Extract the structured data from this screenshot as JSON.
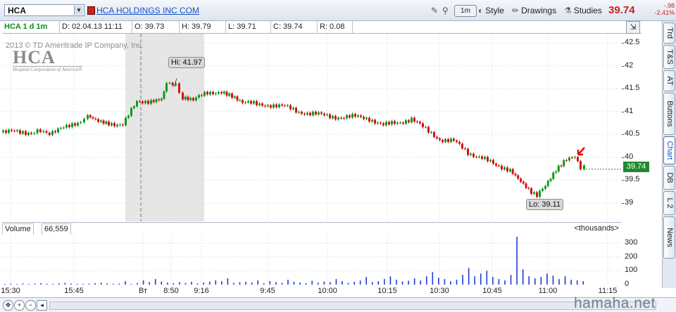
{
  "toolbar": {
    "symbol": "HCA",
    "company_name": "HCA HOLDINGS INC COM",
    "interval": "1m",
    "style_label": "Style",
    "drawings_label": "Drawings",
    "studies_label": "Studies",
    "last_price": "39.74",
    "net_change": "-.98",
    "pct_change": "-2.41%"
  },
  "info": {
    "ticker_interval": "HCA 1 d 1m",
    "date": "D: 02.04.13 11:11",
    "open": "O: 39.73",
    "high": "H: 39.79",
    "low": "L: 39.71",
    "close": "C: 39.74",
    "range": "R: 0.08"
  },
  "chart_overlay": {
    "copyright": "2013 © TD Ameritrade IP Company, Inc.",
    "logo_main": "HCA",
    "logo_sub": "Hospital Corporation of America®",
    "hi_label": "Hi: 41.97",
    "lo_label": "Lo: 39.11",
    "price_flag": "39.74"
  },
  "volume_pane": {
    "title": "Volume",
    "value": "66,559",
    "units": "<thousands>"
  },
  "right_tabs": [
    "Trd",
    "T&S",
    "AT",
    "Buttons",
    "Chart",
    "DB",
    "L 2",
    "News"
  ],
  "watermark": "hamaha.net",
  "chart_data": {
    "type": "candlestick",
    "price_axis_ticks": [
      "42.5",
      "42",
      "41.5",
      "41",
      "40.5",
      "40",
      "39.5",
      "39"
    ],
    "volume_axis_ticks": [
      "300",
      "200",
      "100",
      "0"
    ],
    "time_axis_ticks": [
      "15:30",
      "15:45",
      "Вт",
      "8:50",
      "9:16",
      "9:45",
      "10:00",
      "10:15",
      "10:30",
      "10:45",
      "11:00",
      "11:15"
    ],
    "high": 41.97,
    "low": 39.11,
    "last": 39.74,
    "ylim": [
      38.6,
      42.7
    ],
    "volume_ylim": [
      0,
      350
    ],
    "price_path": [
      [
        0,
        40.55
      ],
      [
        40,
        40.55
      ],
      [
        70,
        40.55
      ],
      [
        90,
        40.65
      ],
      [
        110,
        40.8
      ],
      [
        120,
        40.9
      ],
      [
        135,
        40.8
      ],
      [
        150,
        40.75
      ],
      [
        170,
        40.72
      ],
      [
        190,
        41.2
      ],
      [
        210,
        41.25
      ],
      [
        225,
        41.3
      ],
      [
        232,
        41.65
      ],
      [
        245,
        41.55
      ],
      [
        255,
        41.3
      ],
      [
        270,
        41.25
      ],
      [
        290,
        41.4
      ],
      [
        310,
        41.45
      ],
      [
        325,
        41.35
      ],
      [
        340,
        41.2
      ],
      [
        360,
        41.15
      ],
      [
        380,
        41.15
      ],
      [
        400,
        41.1
      ],
      [
        420,
        41.0
      ],
      [
        440,
        40.95
      ],
      [
        460,
        40.9
      ],
      [
        480,
        40.88
      ],
      [
        500,
        40.88
      ],
      [
        520,
        40.85
      ],
      [
        540,
        40.7
      ],
      [
        560,
        40.75
      ],
      [
        580,
        40.85
      ],
      [
        600,
        40.6
      ],
      [
        620,
        40.4
      ],
      [
        640,
        40.35
      ],
      [
        660,
        40.1
      ],
      [
        680,
        40.0
      ],
      [
        700,
        39.8
      ],
      [
        720,
        39.75
      ],
      [
        735,
        39.5
      ],
      [
        750,
        39.25
      ],
      [
        758,
        39.15
      ],
      [
        770,
        39.35
      ],
      [
        785,
        39.7
      ],
      [
        800,
        39.95
      ],
      [
        812,
        40.05
      ],
      [
        820,
        39.8
      ],
      [
        830,
        39.74
      ]
    ],
    "volume": [
      5,
      6,
      4,
      8,
      5,
      7,
      10,
      6,
      5,
      9,
      12,
      8,
      6,
      5,
      7,
      10,
      14,
      9,
      6,
      8,
      25,
      5,
      12,
      30,
      18,
      40,
      22,
      15,
      10,
      18,
      12,
      20,
      8,
      15,
      22,
      30,
      25,
      45,
      12,
      18,
      20,
      15,
      30,
      10,
      25,
      18,
      12,
      35,
      20,
      15,
      10,
      28,
      14,
      22,
      18,
      40,
      25,
      12,
      20,
      30,
      55,
      18,
      25,
      40,
      60,
      35,
      22,
      28,
      45,
      30,
      60,
      90,
      50,
      40,
      25,
      35,
      70,
      120,
      60,
      80,
      100,
      55,
      40,
      30,
      70,
      345,
      110,
      60,
      45,
      55,
      80,
      65,
      40,
      60,
      35,
      30,
      25
    ]
  }
}
